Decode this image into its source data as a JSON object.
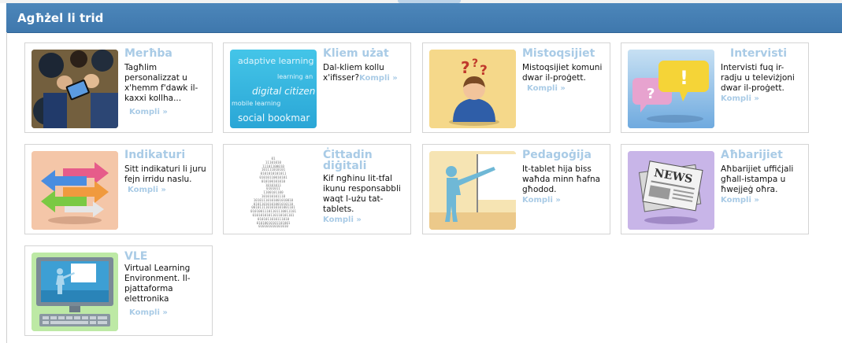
{
  "header": {
    "title": "Agħżel li trid"
  },
  "tiles": [
    {
      "title": "Merħba",
      "description": "Tagħlim personalizzat u x'hemm f'dawk il-kaxxi kollha...",
      "more": "Kompli »"
    },
    {
      "title": "Kliem użat",
      "description": "Dal-kliem kollu x'ifisser?",
      "more": "Kompli »"
    },
    {
      "title": "Mistoqsijiet",
      "description": "Mistoqsijiet komuni dwar il-proġett.",
      "more": "Kompli »"
    },
    {
      "title": "Intervisti",
      "description": "Intervisti fuq ir-radju u televiżjoni dwar il-proġett.",
      "more": "Kompli »"
    },
    {
      "title": "Indikaturi",
      "description": "Sitt indikaturi li juru fejn irridu naslu.",
      "more": "Kompli »"
    },
    {
      "title": "Ċittadin diġitali",
      "description": "Kif ngħinu lit-tfal ikunu responsabbli waqt l-użu tat-tablets.",
      "more": "Kompli »"
    },
    {
      "title": "Pedagoġija",
      "description": "It-tablet hija biss waħda minn ħafna għodod.",
      "more": "Kompli »"
    },
    {
      "title": "Aħbarijiet",
      "description": "Aħbarijiet uffiċjali għall-istampa u ħwejjeġ oħra.",
      "more": "Kompli »"
    },
    {
      "title": "VLE",
      "description": "Virtual Learning Environment. Il-pjattaforma elettronika",
      "more": "Kompli »"
    }
  ],
  "word_cloud": [
    "adaptive learning",
    "learning an",
    "digital citizen",
    "mobile learning",
    "social bookmar"
  ],
  "binary_text": [
    "01",
    "11101010",
    "11101100010",
    "101111010101",
    "0101010101011",
    "01010110010101",
    "010100101010",
    "10101011",
    "0101011",
    "1100101100",
    "101010101110",
    "10101110101001010010",
    "01011010101001010110",
    "0010111101010101001101",
    "01010011101101110011101",
    "010101010110110101101",
    "0101011010111010",
    "01010010101101001",
    "010101010101010"
  ],
  "news_label": "NEWS",
  "colors": {
    "header": "#4380b4",
    "accent": "#a9cbe6",
    "border": "#d4d4d4"
  }
}
